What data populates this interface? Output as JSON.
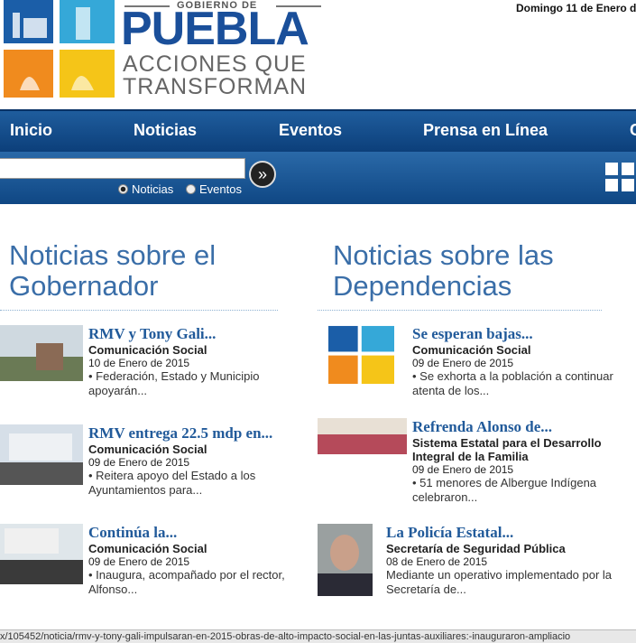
{
  "header": {
    "gobierno": "GOBIERNO DE",
    "puebla": "PUEBLA",
    "slogan1": "ACCIONES QUE",
    "slogan2": "TRANSFORMAN",
    "date_prefix": "Domingo ",
    "date_day": "11",
    "date_rest": " de Enero d"
  },
  "nav": {
    "items": [
      "Inicio",
      "Noticias",
      "Eventos",
      "Prensa en Línea"
    ]
  },
  "search": {
    "value": "",
    "go_label": "»",
    "radio1": "Noticias",
    "radio2": "Eventos"
  },
  "left": {
    "heading1": "Noticias sobre el",
    "heading2": "Gobernador",
    "items": [
      {
        "title": "RMV y Tony Gali...",
        "source": "Comunicación Social",
        "date": "10 de Enero de 2015",
        "summary": "• Federación, Estado y Municipio apoyarán..."
      },
      {
        "title": "RMV entrega 22.5 mdp en...",
        "source": "Comunicación Social",
        "date": "09 de Enero de 2015",
        "summary": "• Reitera apoyo del Estado a los Ayuntamientos para..."
      },
      {
        "title": "Continúa la...",
        "source": "Comunicación Social",
        "date": "09 de Enero de 2015",
        "summary": "• Inaugura, acompañado por el rector, Alfonso..."
      }
    ]
  },
  "right": {
    "heading1": "Noticias sobre las",
    "heading2": "Dependencias",
    "items": [
      {
        "title": "Se esperan bajas...",
        "source": "Comunicación Social",
        "date": "09 de Enero de 2015",
        "summary": "• Se exhorta a la población a continuar atenta de los..."
      },
      {
        "title": "Refrenda Alonso de...",
        "source": "Sistema Estatal para el Desarrollo Integral de la Familia",
        "date": "09 de Enero de 2015",
        "summary": "• 51 menores de Albergue Indígena celebraron..."
      },
      {
        "title": "La Policía Estatal...",
        "source": "Secretaría de Seguridad Pública",
        "date": "08 de Enero de 2015",
        "summary": "Mediante un operativo implementado por la Secretaría de..."
      }
    ]
  },
  "status": {
    "url": "x/105452/noticia/rmv-y-tony-gali-impulsaran-en-2015-obras-de-alto-impacto-social-en-las-juntas-auxiliares:-inauguraron-ampliacio"
  },
  "colors": {
    "brand_blue": "#1a4f9a",
    "nav_blue": "#0c3f7a",
    "title_blue": "#215a9a"
  }
}
